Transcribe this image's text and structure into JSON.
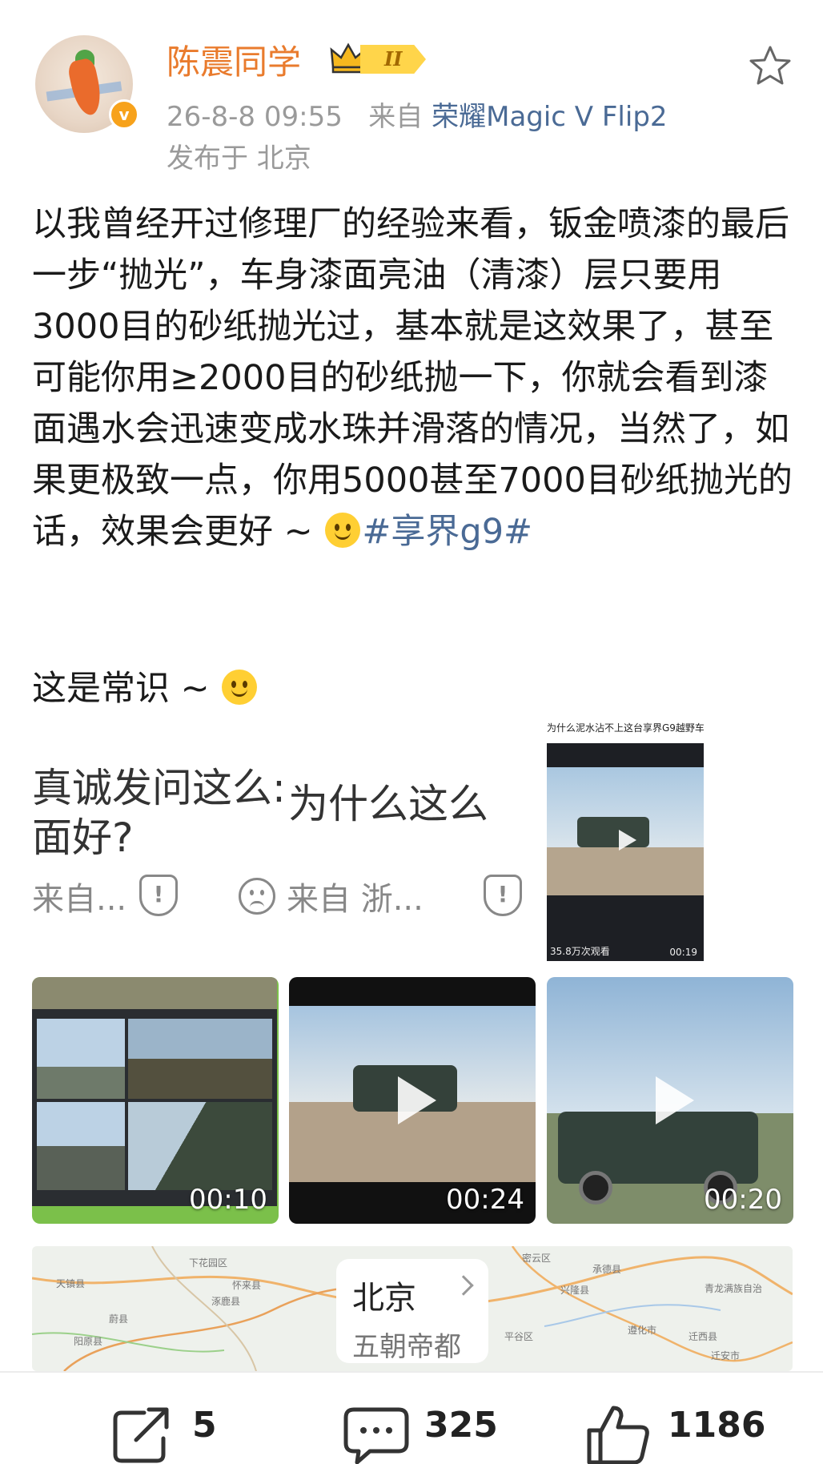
{
  "post": {
    "username": "陈震同学",
    "level_badge": "II",
    "time": "26-8-8 09:55",
    "from_label": "来自",
    "device": "荣耀Magic V Flip2",
    "location": "发布于 北京",
    "content_main": "以我曾经开过修理厂的经验来看，钣金喷漆的最后一步“抛光”，车身漆面亮油（清漆）层只要用3000目的砂纸抛光过，基本就是这效果了，甚至可能你用≥2000目的砂纸抛一下，你就会看到漆面遇水会迅速变成水珠并滑落的情况，当然了，如果更极致一点，你用5000甚至7000目砂纸抛光的话，效果会更好 ~ ",
    "hashtag": "#享界g9#",
    "content_second": "这是常识 ~ "
  },
  "media": {
    "screenshot": {
      "text_a": "真诚发问这么:",
      "text_b": "为什么这么",
      "text_c": "面好?",
      "row_left": "来自...",
      "row_right": "来自 浙..."
    },
    "video_card": {
      "caption": "为什么泥水沾不上这台享界G9越野车?",
      "views": "35.8万次观看",
      "duration": "00:19"
    },
    "videos": [
      {
        "duration": "00:10"
      },
      {
        "duration": "00:24"
      },
      {
        "duration": "00:20"
      }
    ]
  },
  "map": {
    "city": "北京",
    "description": "五朝帝都",
    "towns": [
      "天镇县",
      "下花园区",
      "怀来县",
      "涿鹿县",
      "阳原县",
      "承德县",
      "兴隆县",
      "青龙满族自治",
      "遵化市",
      "迁西县",
      "迁安市",
      "平谷区",
      "密云区",
      "蔚县"
    ]
  },
  "actions": {
    "reposts": "5",
    "comments": "325",
    "likes": "1186"
  },
  "colors": {
    "username": "#e97b2d",
    "link": "#4a6a95",
    "meta": "#9a9a9a"
  }
}
